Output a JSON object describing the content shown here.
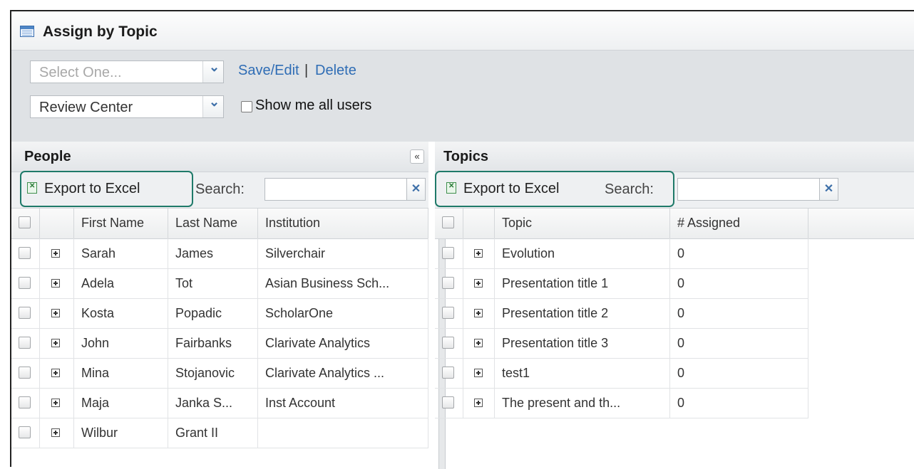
{
  "window": {
    "title": "Assign by Topic"
  },
  "toolbar": {
    "saved_select_placeholder": "Select One...",
    "save_edit_label": "Save/Edit",
    "separator": "|",
    "delete_label": "Delete",
    "role_select_value": "Review Center",
    "show_all_users_label": "Show me all users",
    "show_all_users_checked": false
  },
  "people": {
    "title": "People",
    "export_label": "Export to Excel",
    "search_label": "Search:",
    "search_value": "",
    "columns": [
      "First Name",
      "Last Name",
      "Institution"
    ],
    "rows": [
      {
        "first": "Sarah",
        "last": "James",
        "institution": "Silverchair"
      },
      {
        "first": "Adela",
        "last": "Tot",
        "institution": "Asian Business Sch..."
      },
      {
        "first": "Kosta",
        "last": "Popadic",
        "institution": "ScholarOne"
      },
      {
        "first": "John",
        "last": "Fairbanks",
        "institution": "Clarivate Analytics"
      },
      {
        "first": "Mina",
        "last": "Stojanovic",
        "institution": "Clarivate Analytics ..."
      },
      {
        "first": "Maja",
        "last": "Janka S...",
        "institution": "Inst Account"
      },
      {
        "first": "Wilbur",
        "last": "Grant II",
        "institution": ""
      }
    ]
  },
  "topics": {
    "title": "Topics",
    "export_label": "Export to Excel",
    "search_label": "Search:",
    "search_value": "",
    "columns": [
      "Topic",
      "# Assigned"
    ],
    "rows": [
      {
        "topic": "Evolution",
        "assigned": "0"
      },
      {
        "topic": "Presentation title 1",
        "assigned": "0"
      },
      {
        "topic": "Presentation title 2",
        "assigned": "0"
      },
      {
        "topic": "Presentation title 3",
        "assigned": "0"
      },
      {
        "topic": "test1",
        "assigned": "0"
      },
      {
        "topic": "The present and th...",
        "assigned": "0"
      }
    ]
  },
  "colors": {
    "link": "#2f6db5",
    "highlight": "#1f7a69",
    "excel": "#2a7a37"
  }
}
